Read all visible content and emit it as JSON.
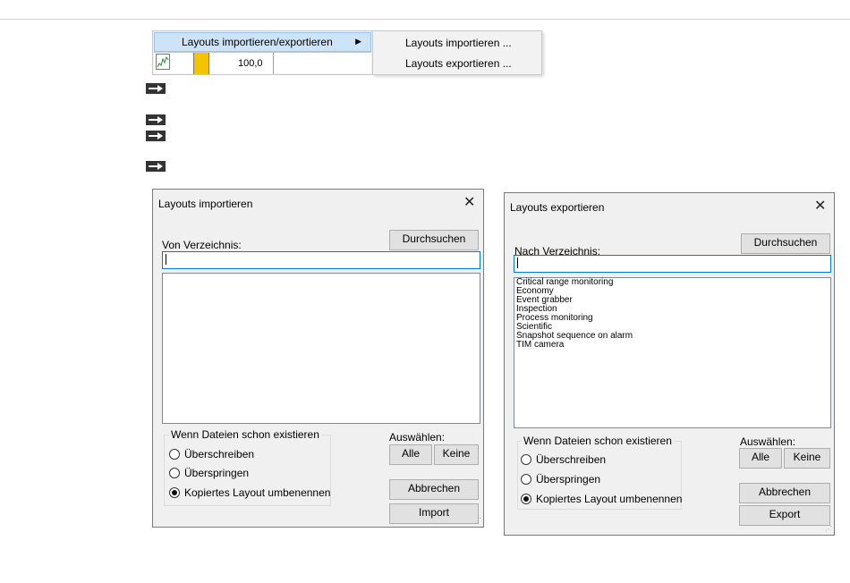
{
  "menu": {
    "item_label": "Layouts importieren/exportieren",
    "value_cell": "100,0",
    "submenu_items": [
      "Layouts importieren ...",
      "Layouts exportieren ..."
    ]
  },
  "import_dialog": {
    "title": "Layouts importieren",
    "dir_label": "Von Verzeichnis:",
    "browse_label": "Durchsuchen",
    "path_value": "",
    "list_items": [],
    "group_title": "Wenn Dateien schon existieren",
    "options": [
      "Überschreiben",
      "Überspringen",
      "Kopiertes Layout umbenennen"
    ],
    "selected_option": 2,
    "select_label": "Auswählen:",
    "all_label": "Alle",
    "none_label": "Keine",
    "cancel_label": "Abbrechen",
    "action_label": "Import"
  },
  "export_dialog": {
    "title": "Layouts exportieren",
    "dir_label": "Nach Verzeichnis:",
    "browse_label": "Durchsuchen",
    "path_value": "",
    "list_items": [
      "Critical range monitoring",
      "Economy",
      "Event grabber",
      "Inspection",
      "Process monitoring",
      "Scientific",
      "Snapshot sequence on alarm",
      "TIM camera"
    ],
    "group_title": "Wenn Dateien schon existieren",
    "options": [
      "Überschreiben",
      "Überspringen",
      "Kopiertes Layout umbenennen"
    ],
    "selected_option": 2,
    "select_label": "Auswählen:",
    "all_label": "Alle",
    "none_label": "Keine",
    "cancel_label": "Abbrechen",
    "action_label": "Export"
  },
  "close_symbol": "✕",
  "icons": {
    "step": "right-arrow-icon",
    "submenu": "chevron-right-icon"
  }
}
